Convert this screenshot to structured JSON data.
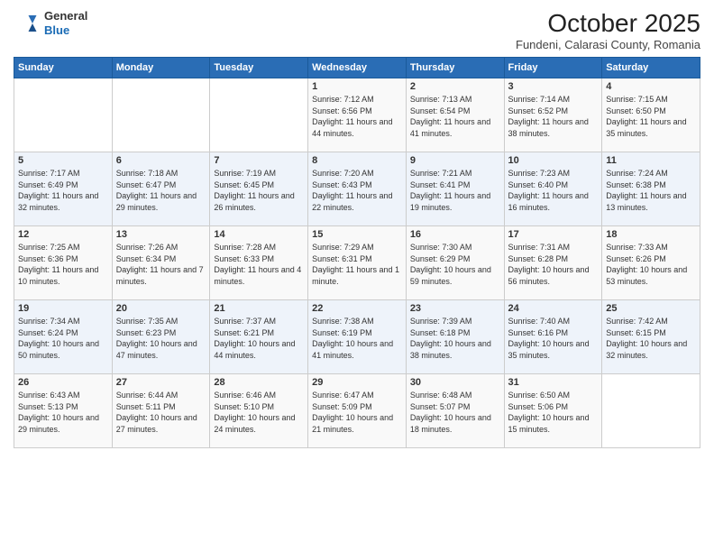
{
  "header": {
    "logo_line1": "General",
    "logo_line2": "Blue",
    "month": "October 2025",
    "location": "Fundeni, Calarasi County, Romania"
  },
  "days_of_week": [
    "Sunday",
    "Monday",
    "Tuesday",
    "Wednesday",
    "Thursday",
    "Friday",
    "Saturday"
  ],
  "weeks": [
    [
      {
        "day": "",
        "info": ""
      },
      {
        "day": "",
        "info": ""
      },
      {
        "day": "",
        "info": ""
      },
      {
        "day": "1",
        "info": "Sunrise: 7:12 AM\nSunset: 6:56 PM\nDaylight: 11 hours and 44 minutes."
      },
      {
        "day": "2",
        "info": "Sunrise: 7:13 AM\nSunset: 6:54 PM\nDaylight: 11 hours and 41 minutes."
      },
      {
        "day": "3",
        "info": "Sunrise: 7:14 AM\nSunset: 6:52 PM\nDaylight: 11 hours and 38 minutes."
      },
      {
        "day": "4",
        "info": "Sunrise: 7:15 AM\nSunset: 6:50 PM\nDaylight: 11 hours and 35 minutes."
      }
    ],
    [
      {
        "day": "5",
        "info": "Sunrise: 7:17 AM\nSunset: 6:49 PM\nDaylight: 11 hours and 32 minutes."
      },
      {
        "day": "6",
        "info": "Sunrise: 7:18 AM\nSunset: 6:47 PM\nDaylight: 11 hours and 29 minutes."
      },
      {
        "day": "7",
        "info": "Sunrise: 7:19 AM\nSunset: 6:45 PM\nDaylight: 11 hours and 26 minutes."
      },
      {
        "day": "8",
        "info": "Sunrise: 7:20 AM\nSunset: 6:43 PM\nDaylight: 11 hours and 22 minutes."
      },
      {
        "day": "9",
        "info": "Sunrise: 7:21 AM\nSunset: 6:41 PM\nDaylight: 11 hours and 19 minutes."
      },
      {
        "day": "10",
        "info": "Sunrise: 7:23 AM\nSunset: 6:40 PM\nDaylight: 11 hours and 16 minutes."
      },
      {
        "day": "11",
        "info": "Sunrise: 7:24 AM\nSunset: 6:38 PM\nDaylight: 11 hours and 13 minutes."
      }
    ],
    [
      {
        "day": "12",
        "info": "Sunrise: 7:25 AM\nSunset: 6:36 PM\nDaylight: 11 hours and 10 minutes."
      },
      {
        "day": "13",
        "info": "Sunrise: 7:26 AM\nSunset: 6:34 PM\nDaylight: 11 hours and 7 minutes."
      },
      {
        "day": "14",
        "info": "Sunrise: 7:28 AM\nSunset: 6:33 PM\nDaylight: 11 hours and 4 minutes."
      },
      {
        "day": "15",
        "info": "Sunrise: 7:29 AM\nSunset: 6:31 PM\nDaylight: 11 hours and 1 minute."
      },
      {
        "day": "16",
        "info": "Sunrise: 7:30 AM\nSunset: 6:29 PM\nDaylight: 10 hours and 59 minutes."
      },
      {
        "day": "17",
        "info": "Sunrise: 7:31 AM\nSunset: 6:28 PM\nDaylight: 10 hours and 56 minutes."
      },
      {
        "day": "18",
        "info": "Sunrise: 7:33 AM\nSunset: 6:26 PM\nDaylight: 10 hours and 53 minutes."
      }
    ],
    [
      {
        "day": "19",
        "info": "Sunrise: 7:34 AM\nSunset: 6:24 PM\nDaylight: 10 hours and 50 minutes."
      },
      {
        "day": "20",
        "info": "Sunrise: 7:35 AM\nSunset: 6:23 PM\nDaylight: 10 hours and 47 minutes."
      },
      {
        "day": "21",
        "info": "Sunrise: 7:37 AM\nSunset: 6:21 PM\nDaylight: 10 hours and 44 minutes."
      },
      {
        "day": "22",
        "info": "Sunrise: 7:38 AM\nSunset: 6:19 PM\nDaylight: 10 hours and 41 minutes."
      },
      {
        "day": "23",
        "info": "Sunrise: 7:39 AM\nSunset: 6:18 PM\nDaylight: 10 hours and 38 minutes."
      },
      {
        "day": "24",
        "info": "Sunrise: 7:40 AM\nSunset: 6:16 PM\nDaylight: 10 hours and 35 minutes."
      },
      {
        "day": "25",
        "info": "Sunrise: 7:42 AM\nSunset: 6:15 PM\nDaylight: 10 hours and 32 minutes."
      }
    ],
    [
      {
        "day": "26",
        "info": "Sunrise: 6:43 AM\nSunset: 5:13 PM\nDaylight: 10 hours and 29 minutes."
      },
      {
        "day": "27",
        "info": "Sunrise: 6:44 AM\nSunset: 5:11 PM\nDaylight: 10 hours and 27 minutes."
      },
      {
        "day": "28",
        "info": "Sunrise: 6:46 AM\nSunset: 5:10 PM\nDaylight: 10 hours and 24 minutes."
      },
      {
        "day": "29",
        "info": "Sunrise: 6:47 AM\nSunset: 5:09 PM\nDaylight: 10 hours and 21 minutes."
      },
      {
        "day": "30",
        "info": "Sunrise: 6:48 AM\nSunset: 5:07 PM\nDaylight: 10 hours and 18 minutes."
      },
      {
        "day": "31",
        "info": "Sunrise: 6:50 AM\nSunset: 5:06 PM\nDaylight: 10 hours and 15 minutes."
      },
      {
        "day": "",
        "info": ""
      }
    ]
  ]
}
